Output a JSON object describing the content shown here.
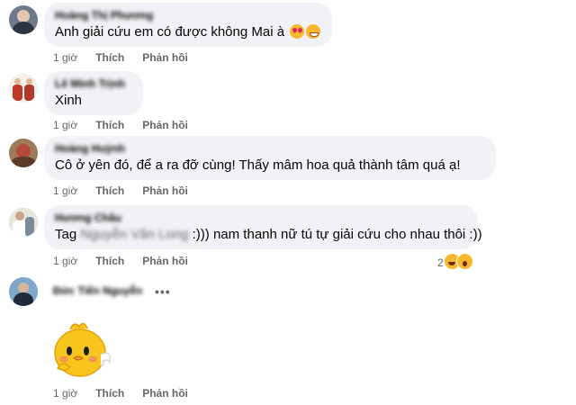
{
  "actions": {
    "time": "1 giờ",
    "like": "Thích",
    "reply": "Phản hồi"
  },
  "comments": [
    {
      "author": "Hoàng Thị Phương",
      "text": "Anh giải cứu em có được không Mai à"
    },
    {
      "author": "Lê Minh Trịnh",
      "text": "Xinh"
    },
    {
      "author": "Hoàng Huỳnh",
      "text": "Cô ở yên đó, để a ra đỡ cùng! Thấy mâm hoa quả thành tâm quá ạ!"
    },
    {
      "author": "Hương Châu",
      "text_prefix": "Tag",
      "tagged": "Nguyễn Văn Long",
      "text_suffix": ":))) nam thanh nữ tú tự giải cứu cho nhau thôi :))",
      "reaction_count": "2"
    },
    {
      "author": "Đức Tiến Nguyễn",
      "more": "•••"
    }
  ],
  "icons": {
    "emoji_1": "heart-eyes-emoji-icon",
    "emoji_2": "grinning-emoji-icon",
    "reactions": "haha-wow-reaction-icon",
    "sticker": "yellow-chick-sticker-icon"
  },
  "colors": {
    "bubble": "#f0f2f5",
    "meta_text": "#65676b",
    "text": "#050505"
  }
}
